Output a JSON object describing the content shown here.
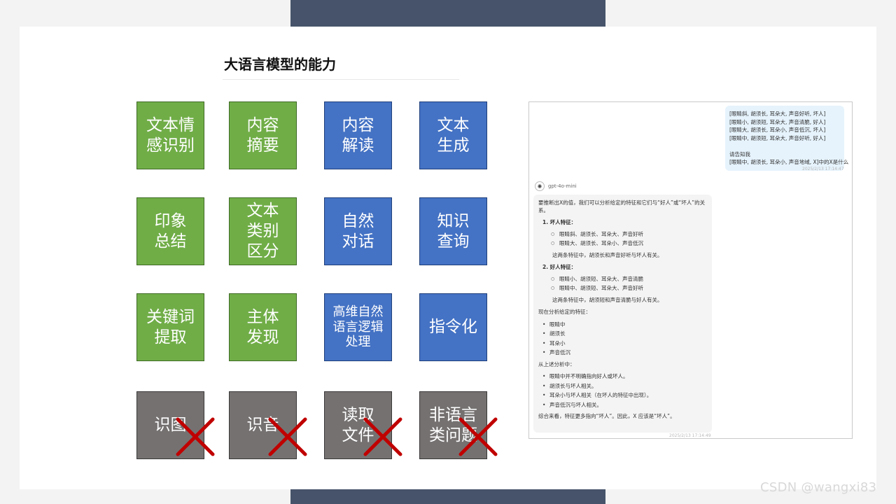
{
  "title": "大语言模型的能力",
  "tiles": [
    {
      "label": "文本情\n感识别",
      "color": "green"
    },
    {
      "label": "内容\n摘要",
      "color": "green"
    },
    {
      "label": "内容\n解读",
      "color": "blue"
    },
    {
      "label": "文本\n生成",
      "color": "blue"
    },
    {
      "label": "印象\n总结",
      "color": "green"
    },
    {
      "label": "文本\n类别\n区分",
      "color": "green"
    },
    {
      "label": "自然\n对话",
      "color": "blue"
    },
    {
      "label": "知识\n查询",
      "color": "blue"
    },
    {
      "label": "关键词\n提取",
      "color": "green"
    },
    {
      "label": "主体\n发现",
      "color": "green"
    },
    {
      "label": "高维自然\n语言逻辑\n处理",
      "color": "blue"
    },
    {
      "label": "指令化",
      "color": "blue"
    },
    {
      "label": "识图",
      "color": "gray",
      "crossed": true
    },
    {
      "label": "识音",
      "color": "gray",
      "crossed": true
    },
    {
      "label": "读取\n文件",
      "color": "gray",
      "crossed": true
    },
    {
      "label": "非语言\n类问题",
      "color": "gray",
      "crossed": true
    }
  ],
  "colors": {
    "green": "#70ad47",
    "blue": "#4472c4",
    "gray": "#757171",
    "cross": "#c00000"
  },
  "chat": {
    "user_lines": [
      "[眼睛斜, 胡须长, 耳朵大, 声音好听, 坏人]",
      "[眼睛小, 胡须短, 耳朵大, 声音清脆, 好人]",
      "[眼睛大, 胡须长, 耳朵小, 声音低沉, 坏人]",
      "[眼睛中, 胡须短, 耳朵大, 声音好听, 好人]",
      "",
      "请告知我",
      "[眼睛中, 胡须长, 耳朵小, 声音地域, X]中的X是什么"
    ],
    "user_time": "2025/2/13 17:14:47",
    "model_name": "gpt-4o-mini",
    "model_icon": "openai-icon",
    "answer": {
      "intro": "要推断出X的值，我们可以分析给定的特征和它们与“好人”或“坏人”的关系。",
      "bad_title": "1. 坏人特征：",
      "bad_items": [
        "眼睛斜、胡须长、耳朵大、声音好听",
        "眼睛大、胡须长、耳朵小、声音低沉"
      ],
      "bad_note": "这两条特征中，胡须长和声音好听与坏人有关。",
      "good_title": "2. 好人特征：",
      "good_items": [
        "眼睛小、胡须短、耳朵大、声音清脆",
        "眼睛中、胡须短、耳朵大、声音好听"
      ],
      "good_note": "这两条特征中，胡须短和声音清脆与好人有关。",
      "given_title": "现在分析给定的特征：",
      "given_items": [
        "眼睛中",
        "胡须长",
        "耳朵小",
        "声音低沉"
      ],
      "analysis_title": "从上述分析中：",
      "analysis_items": [
        "眼睛中并不明确指向好人或坏人。",
        "胡须长与坏人相关。",
        "耳朵小与坏人相关（在坏人的特征中出现）。",
        "声音低沉与坏人相关。"
      ],
      "conclusion": "综合来看，特征更多指向“坏人”。因此，X 应该是“坏人”。"
    },
    "answer_time": "2025/2/13 17:14:49"
  },
  "watermark": "CSDN @wangxi83"
}
